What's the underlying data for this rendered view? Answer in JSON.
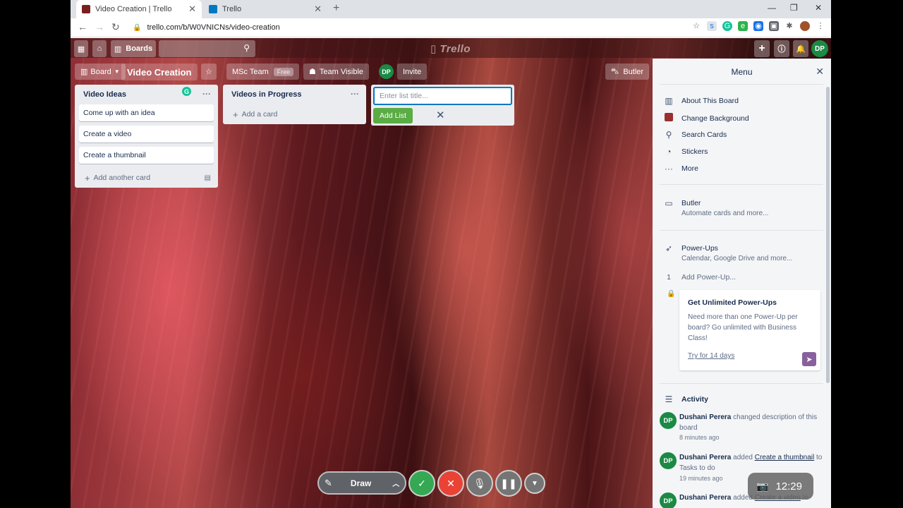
{
  "browser": {
    "tabs": [
      {
        "title": "Video Creation | Trello",
        "active": true
      },
      {
        "title": "Trello",
        "active": false
      }
    ],
    "url": "trello.com/b/W0VNICNs/video-creation"
  },
  "header": {
    "boards_label": "Boards",
    "logo": "Trello",
    "user_initials": "DP"
  },
  "board": {
    "view_label": "Board",
    "title": "Video Creation",
    "team_label": "MSc Team",
    "team_badge": "Free",
    "visibility_label": "Team Visible",
    "member_initials": "DP",
    "invite_label": "Invite",
    "butler_label": "Butler"
  },
  "lists": [
    {
      "title": "Video Ideas",
      "cards": [
        "Come up with an idea",
        "Create a video",
        "Create a thumbnail"
      ],
      "add_label": "Add another card"
    },
    {
      "title": "Videos in Progress",
      "cards": [],
      "add_label": "Add a card"
    }
  ],
  "add_list": {
    "placeholder": "Enter list title...",
    "button_label": "Add List"
  },
  "menu": {
    "title": "Menu",
    "items": [
      {
        "label": "About This Board",
        "icon": "board-icon"
      },
      {
        "label": "Change Background",
        "icon": "background-swatch-icon"
      },
      {
        "label": "Search Cards",
        "icon": "search-icon"
      },
      {
        "label": "Stickers",
        "icon": "sticker-icon"
      },
      {
        "label": "More",
        "icon": "ellipsis-icon"
      }
    ],
    "butler": {
      "label": "Butler",
      "sub": "Automate cards and more..."
    },
    "powerups": {
      "label": "Power-Ups",
      "sub": "Calendar, Google Drive and more...",
      "count": "1",
      "add_label": "Add Power-Up..."
    },
    "promo": {
      "title": "Get Unlimited Power-Ups",
      "desc": "Need more than one Power-Up per board? Go unlimited with Business Class!",
      "link": "Try for 14 days"
    },
    "activity": {
      "label": "Activity",
      "entries": [
        {
          "user": "Dushani Perera",
          "initials": "DP",
          "text": "changed description of this board",
          "time": "8 minutes ago"
        },
        {
          "user": "Dushani Perera",
          "initials": "DP",
          "text_before": "added",
          "link": "Create a thumbnail",
          "text_after": "to Tasks to do",
          "time": "19 minutes ago"
        },
        {
          "user": "Dushani Perera",
          "initials": "DP",
          "text_before": "added",
          "link": "Create a video",
          "text_after": "to"
        }
      ]
    }
  },
  "recorder": {
    "draw_label": "Draw",
    "clock": "12:29"
  },
  "colors": {
    "accent_blue": "#0079bf",
    "add_green": "#5aac44",
    "avatar_green": "#1a8a44"
  }
}
